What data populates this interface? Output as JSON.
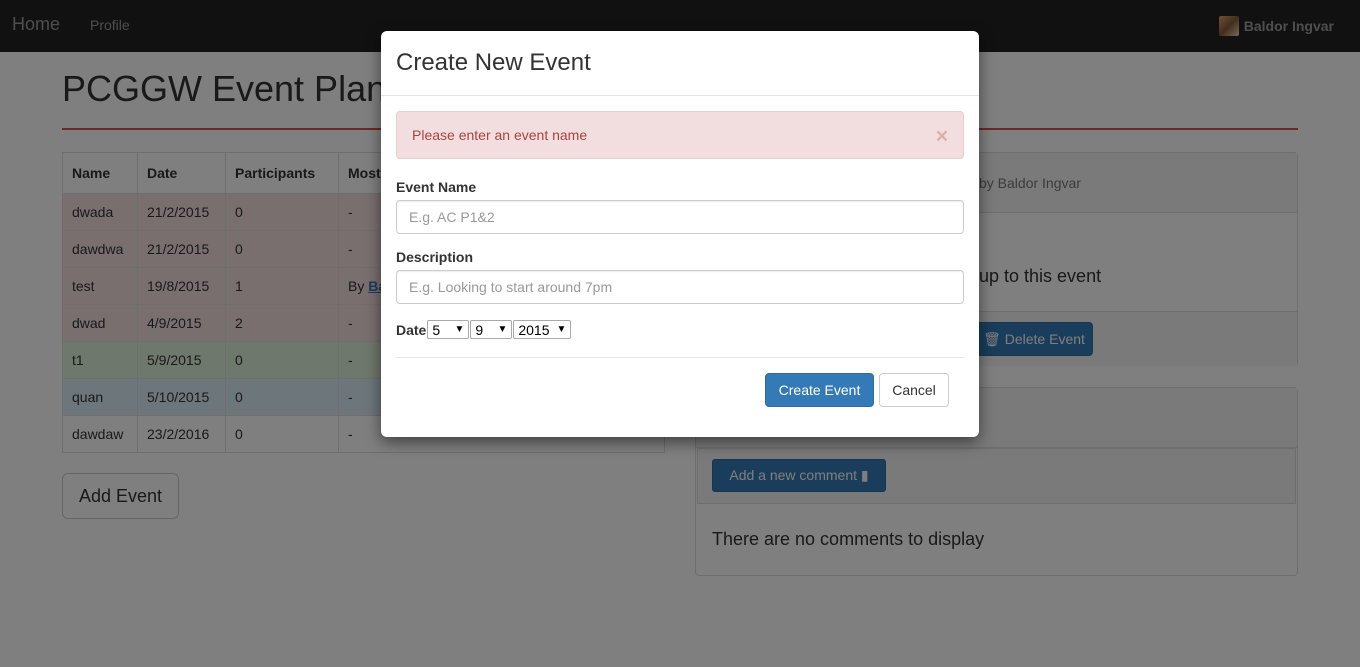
{
  "navbar": {
    "brand": "Home",
    "profile": "Profile",
    "user": "Baldor Ingvar"
  },
  "page": {
    "title": "PCGGW Event Planner"
  },
  "table": {
    "headers": [
      "Name",
      "Date",
      "Participants",
      "Most"
    ],
    "rows": [
      {
        "name": "dwada",
        "date": "21/2/2015",
        "participants": "0",
        "most": "-"
      },
      {
        "name": "dawdwa",
        "date": "21/2/2015",
        "participants": "0",
        "most": "-"
      },
      {
        "name": "test",
        "date": "19/8/2015",
        "participants": "1",
        "most": "By",
        "most_link": "Ba"
      },
      {
        "name": "dwad",
        "date": "4/9/2015",
        "participants": "2",
        "most": "-"
      },
      {
        "name": "t1",
        "date": "5/9/2015",
        "participants": "0",
        "most": "-"
      },
      {
        "name": "quan",
        "date": "5/10/2015",
        "participants": "0",
        "most": "-"
      },
      {
        "name": "dawdaw",
        "date": "23/2/2016",
        "participants": "0",
        "most": "-"
      }
    ]
  },
  "add_event_label": "Add Event",
  "event_panel": {
    "by_line": "by Baldor Ingvar",
    "signup_text": "up to this event",
    "delete_label": "Delete Event"
  },
  "comments_panel": {
    "add_comment_label": "Add a new comment",
    "empty_text": "There are no comments to display"
  },
  "modal": {
    "title": "Create New Event",
    "alert": "Please enter an event name",
    "alert_close": "×",
    "name_label": "Event Name",
    "name_placeholder": "E.g. AC P1&2",
    "description_label": "Description",
    "description_placeholder": "E.g. Looking to start around 7pm",
    "date_label": "Date",
    "date_day": "5",
    "date_month": "9",
    "date_year": "2015",
    "create_label": "Create Event",
    "cancel_label": "Cancel"
  },
  "colors": {
    "navbar": "#222222",
    "accent": "#337ab7",
    "rule": "#d9534f",
    "danger_row": "#f2dede",
    "success_row": "#dff0d8",
    "info_row": "#d9edf7"
  }
}
